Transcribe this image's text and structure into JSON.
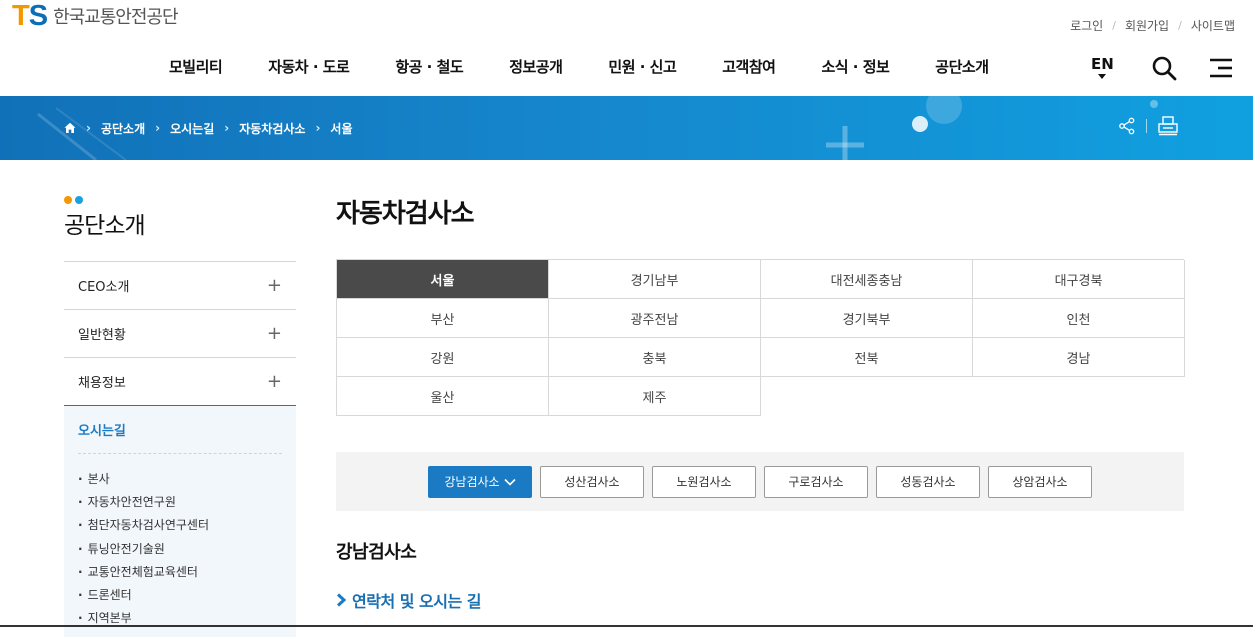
{
  "header": {
    "logo_mark": "TS",
    "logo_name": "한국교통안전공단",
    "util_links": [
      "로그인",
      "회원가입",
      "사이트맵"
    ],
    "nav": [
      "모빌리티",
      "자동차 · 도로",
      "항공 · 철도",
      "정보공개",
      "민원 · 신고",
      "고객참여",
      "소식 · 정보",
      "공단소개"
    ],
    "lang": "EN"
  },
  "breadcrumb": [
    "공단소개",
    "오시는길",
    "자동차검사소",
    "서울"
  ],
  "sidebar": {
    "title": "공단소개",
    "items": [
      "CEO소개",
      "일반현황",
      "채용정보"
    ],
    "active": "오시는길",
    "sub_items": [
      "본사",
      "자동차안전연구원",
      "첨단자동차검사연구센터",
      "튜닝안전기술원",
      "교통안전체험교육센터",
      "드론센터",
      "지역본부"
    ]
  },
  "main": {
    "title": "자동차검사소",
    "regions": [
      "서울",
      "경기남부",
      "대전세종충남",
      "대구경북",
      "부산",
      "광주전남",
      "경기북부",
      "인천",
      "강원",
      "충북",
      "전북",
      "경남",
      "울산",
      "제주"
    ],
    "active_region": "서울",
    "offices": [
      "강남검사소",
      "성산검사소",
      "노원검사소",
      "구로검사소",
      "성동검사소",
      "상암검사소"
    ],
    "active_office": "강남검사소",
    "office_title": "강남검사소",
    "section_title": "연락처 및 오시는 길"
  },
  "colors": {
    "brand_blue": "#1a7bc4",
    "brand_orange": "#f39800",
    "active_region_bg": "#4a4a4a"
  }
}
